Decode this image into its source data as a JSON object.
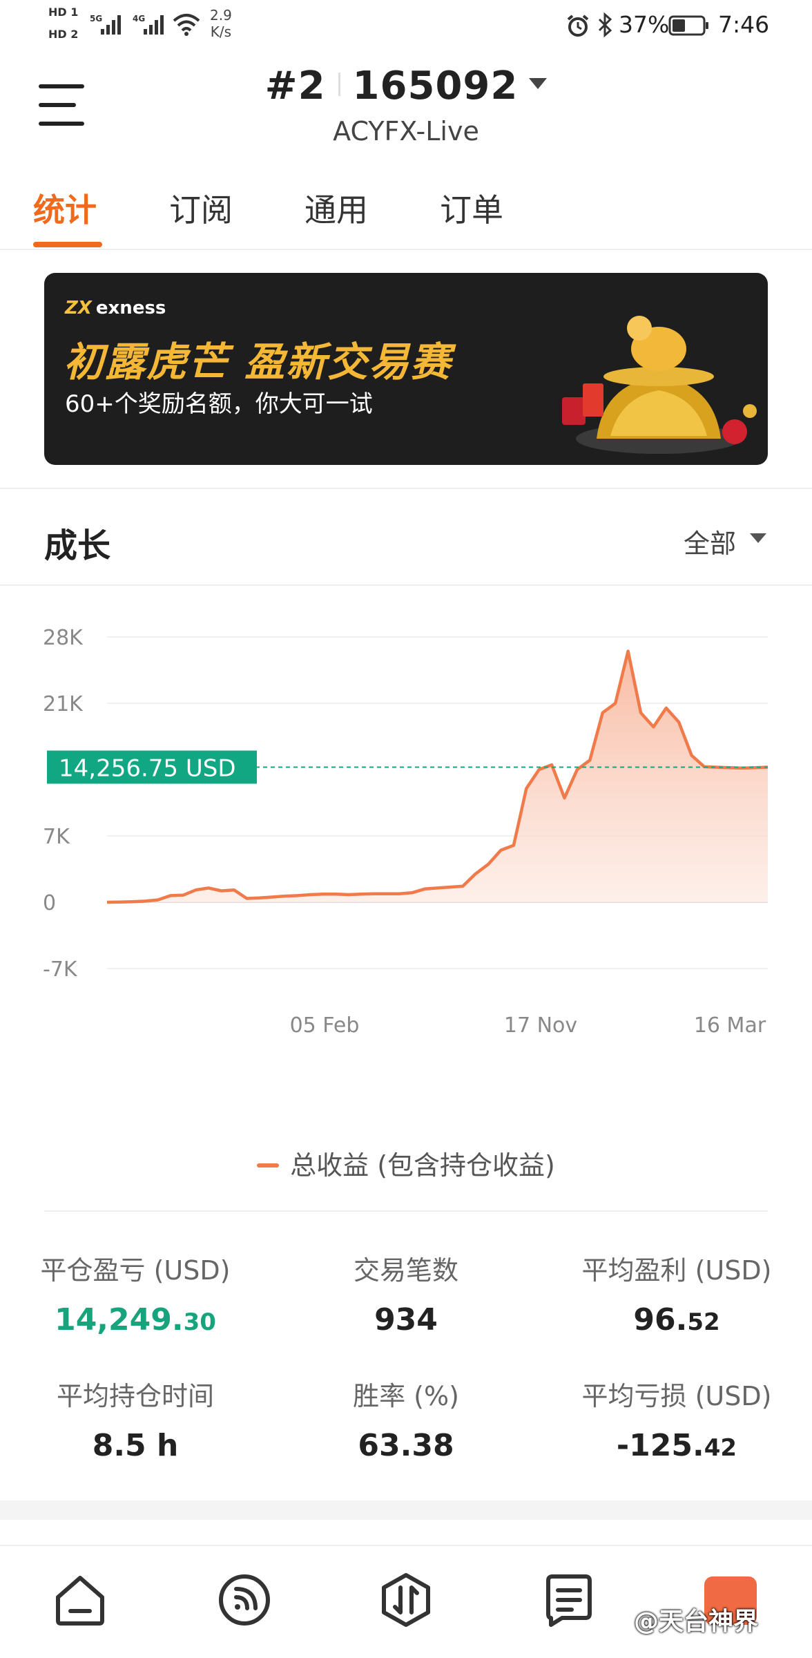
{
  "status_bar": {
    "hd1": "HD 1",
    "hd2": "HD 2",
    "net1": "5G",
    "net2": "4G",
    "speed_value": "2.9",
    "speed_unit": "K/s",
    "battery": "37%",
    "time": "7:46"
  },
  "header": {
    "account_number": "#2",
    "account_id": "165092",
    "server": "ACYFX-Live"
  },
  "tabs": [
    {
      "label": "统计",
      "active": true
    },
    {
      "label": "订阅",
      "active": false
    },
    {
      "label": "通用",
      "active": false
    },
    {
      "label": "订单",
      "active": false
    }
  ],
  "banner": {
    "brand": "exness",
    "brand_mark": "ZX",
    "title": "初露虎芒 盈新交易赛",
    "subtitle": "60+个奖励名额，你大可一试"
  },
  "growth": {
    "title": "成长",
    "filter": "全部"
  },
  "chart_data": {
    "type": "area",
    "y_ticks": [
      "28K",
      "21K",
      "7K",
      "0",
      "-7K"
    ],
    "y_tick_values": [
      28000,
      21000,
      7000,
      0,
      -7000
    ],
    "ylim": [
      -7000,
      28000
    ],
    "x_ticks": [
      "05 Feb",
      "17 Nov",
      "16 Mar"
    ],
    "current_label": "14,256.75 USD",
    "current_value": 14256.75,
    "series": [
      {
        "name": "总收益 (包含持仓收益)",
        "color": "#f07a4a",
        "values": [
          0,
          20,
          60,
          120,
          250,
          700,
          750,
          1300,
          1500,
          1200,
          1300,
          400,
          450,
          550,
          650,
          700,
          800,
          850,
          850,
          800,
          850,
          900,
          900,
          900,
          1000,
          1400,
          1500,
          1600,
          1700,
          3000,
          4000,
          5500,
          6000,
          12000,
          14000,
          14500,
          11000,
          14000,
          15000,
          20000,
          21000,
          26500,
          20000,
          18500,
          20500,
          19000,
          15500,
          14300,
          14250,
          14200,
          14150,
          14200,
          14256.75
        ]
      }
    ]
  },
  "legend_label": "总收益 (包含持仓收益)",
  "stats": [
    {
      "label": "平仓盈亏 (USD)",
      "int": "14,249.",
      "dec": "30",
      "green": true
    },
    {
      "label": "交易笔数",
      "int": "934",
      "dec": ""
    },
    {
      "label": "平均盈利 (USD)",
      "int": "96.",
      "dec": "52"
    },
    {
      "label": "平均持仓时间",
      "int": "8.5 h",
      "dec": ""
    },
    {
      "label": "胜率 (%)",
      "int": "63.38",
      "dec": ""
    },
    {
      "label": "平均亏损 (USD)",
      "int": "-125.",
      "dec": "42"
    }
  ],
  "watermark": "@天台神界",
  "colors": {
    "accent": "#f06a1d",
    "positive": "#17a37b",
    "line": "#f07a4a",
    "fill": "#fde2d6",
    "current_label_bg": "#12a783"
  }
}
